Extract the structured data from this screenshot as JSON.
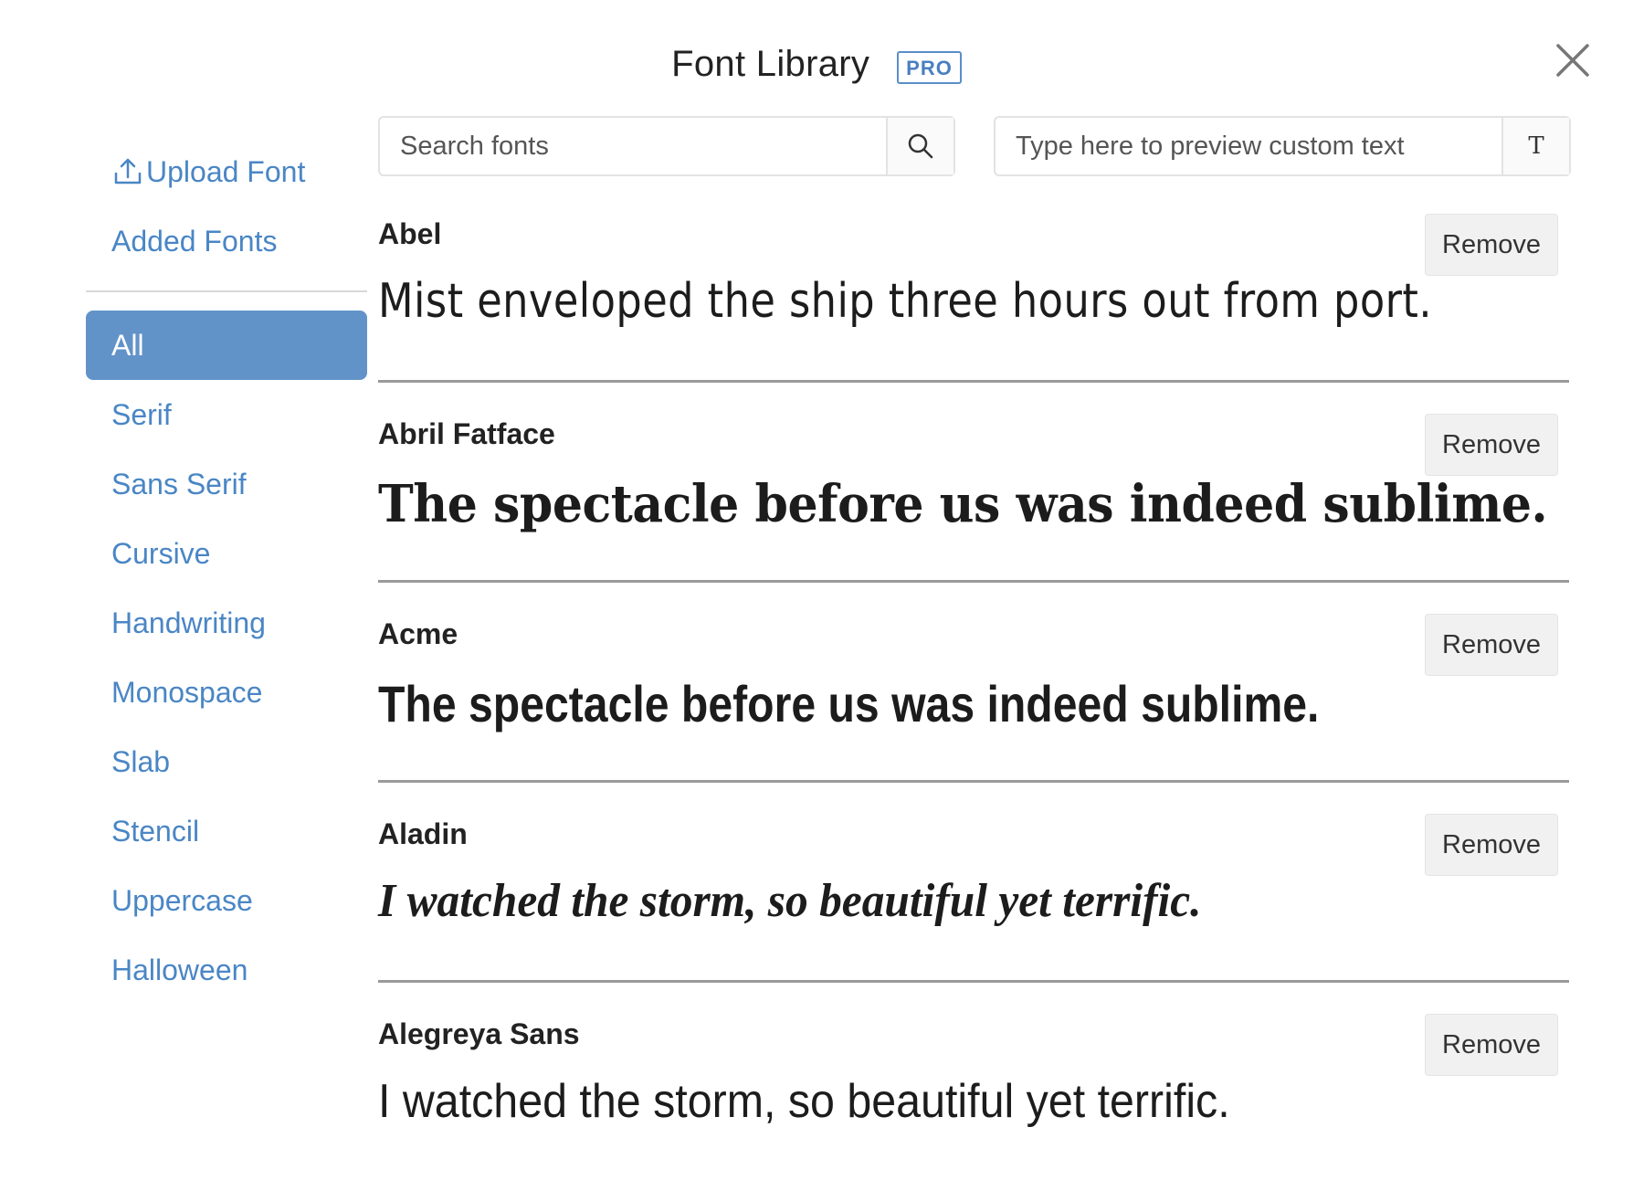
{
  "header": {
    "title": "Font Library",
    "badge": "PRO"
  },
  "sidebar": {
    "upload_label": "Upload Font",
    "added_label": "Added Fonts",
    "categories": [
      "All",
      "Serif",
      "Sans Serif",
      "Cursive",
      "Handwriting",
      "Monospace",
      "Slab",
      "Stencil",
      "Uppercase",
      "Halloween"
    ],
    "active_category": "All"
  },
  "search": {
    "placeholder": "Search fonts",
    "value": ""
  },
  "preview_input": {
    "placeholder": "Type here to preview custom text",
    "value": "",
    "button_glyph": "T"
  },
  "fonts": [
    {
      "name": "Abel",
      "preview": "Mist enveloped the ship three hours out from port.",
      "action": "Remove"
    },
    {
      "name": "Abril Fatface",
      "preview": "The spectacle before us was indeed sublime.",
      "action": "Remove"
    },
    {
      "name": "Acme",
      "preview": "The spectacle before us was indeed sublime.",
      "action": "Remove"
    },
    {
      "name": "Aladin",
      "preview": "I watched the storm, so beautiful yet terrific.",
      "action": "Remove"
    },
    {
      "name": "Alegreya Sans",
      "preview": "I watched the storm, so beautiful yet terrific.",
      "action": "Remove"
    }
  ],
  "colors": {
    "accent": "#4a86c5",
    "active_bg": "#6293c8",
    "badge": "#4a7fc0"
  },
  "icons": {
    "close": "close-icon",
    "upload": "upload-icon",
    "search": "search-icon"
  }
}
